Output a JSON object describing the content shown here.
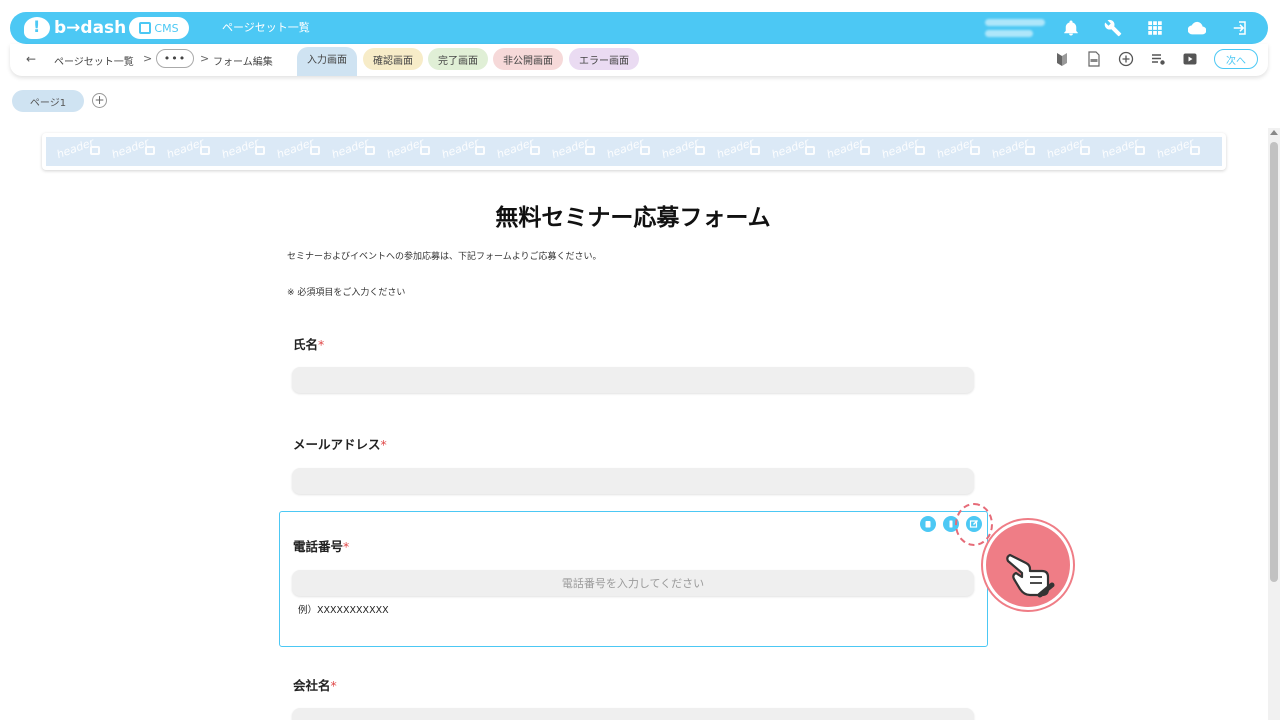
{
  "header": {
    "logo_text": "b→dash",
    "cms_label": "CMS",
    "title": "ページセット一覧",
    "icons": [
      "bell-icon",
      "wrench-icon",
      "grid-icon",
      "cloud-icon",
      "logout-icon"
    ]
  },
  "subbar": {
    "breadcrumb_root": "ページセット一覧",
    "breadcrumb_more": "•••",
    "breadcrumb_current": "フォーム編集",
    "tabs": {
      "input": "入力画面",
      "confirm": "確認画面",
      "done": "完了画面",
      "private": "非公開画面",
      "error": "エラー画面"
    },
    "next_label": "次へ"
  },
  "pages": {
    "page1": "ページ1",
    "add": "+"
  },
  "banner": {
    "watermark": "header"
  },
  "form": {
    "title": "無料セミナー応募フォーム",
    "intro": "セミナーおよびイベントへの参加応募は、下記フォームよりご応募ください。",
    "required_note": "※ 必須項目をご入力ください",
    "required_mark": "*",
    "fields": [
      {
        "label": "氏名",
        "placeholder": ""
      },
      {
        "label": "メールアドレス",
        "placeholder": ""
      },
      {
        "label": "電話番号",
        "placeholder": "電話番号を入力してください",
        "hint": "例）XXXXXXXXXXX"
      },
      {
        "label": "会社名",
        "placeholder": ""
      }
    ]
  },
  "colors": {
    "accent": "#4cc8f4",
    "required": "#e04848",
    "pointer": "#ef7d86"
  }
}
